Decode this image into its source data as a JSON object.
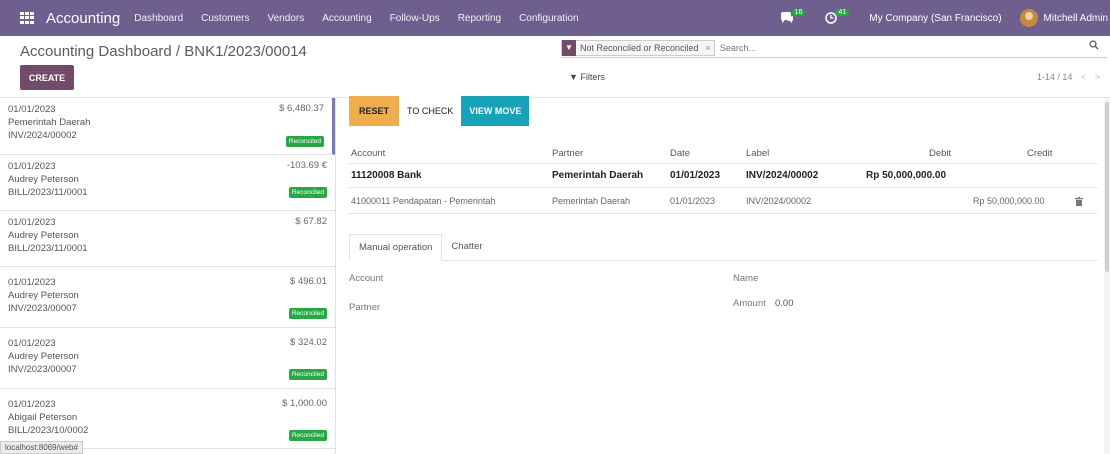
{
  "nav": {
    "app_title": "Accounting",
    "menu": [
      "Dashboard",
      "Customers",
      "Vendors",
      "Accounting",
      "Follow-Ups",
      "Reporting",
      "Configuration"
    ],
    "messages_count": "16",
    "activities_count": "41",
    "company": "My Company (San Francisco)",
    "user": "Mitchell Admin"
  },
  "control": {
    "breadcrumb": "Accounting Dashboard / BNK1/2023/00014",
    "create_label": "CREATE",
    "facet_label": "Not Reconciled or Reconciled",
    "facet_close": "×",
    "search_placeholder": "Search...",
    "filters_label": "Filters",
    "pager": "1-14 / 14"
  },
  "statements": [
    {
      "date": "01/01/2023",
      "partner": "Pemerintah Daerah",
      "ref": "INV/2024/00002",
      "amount": "$ 6,480.37",
      "status": "Reconciled"
    },
    {
      "date": "01/01/2023",
      "partner": "Audrey Peterson",
      "ref": "BILL/2023/11/0001",
      "amount": "-103.69 €",
      "status": "Reconciled"
    },
    {
      "date": "01/01/2023",
      "partner": "Audrey Peterson",
      "ref": "BILL/2023/11/0001",
      "amount": "$ 67.82",
      "status": ""
    },
    {
      "date": "01/01/2023",
      "partner": "Audrey Peterson",
      "ref": "INV/2023/00007",
      "amount": "$ 496.01",
      "status": "Reconciled"
    },
    {
      "date": "01/01/2023",
      "partner": "Audrey Peterson",
      "ref": "INV/2023/00007",
      "amount": "$ 324.02",
      "status": "Reconciled"
    },
    {
      "date": "01/01/2023",
      "partner": "Abigail Peterson",
      "ref": "BILL/2023/10/0002",
      "amount": "$ 1,000.00",
      "status": "Reconciled"
    }
  ],
  "tooltip": "localhost:8069/web#",
  "buttons": {
    "reset": "RESET",
    "to_check": "TO CHECK",
    "view_move": "VIEW MOVE"
  },
  "lines": {
    "headers": {
      "account": "Account",
      "partner": "Partner",
      "date": "Date",
      "label": "Label",
      "debit": "Debit",
      "credit": "Credit"
    },
    "rows": [
      {
        "account": "11120008 Bank",
        "partner": "Pemerintah Daerah",
        "date": "01/01/2023",
        "label": "INV/2024/00002",
        "debit": "Rp 50,000,000.00",
        "credit": ""
      },
      {
        "account": "41000011 Pendapatan - Pemerintah",
        "partner": "Pemerintah Daerah",
        "date": "01/01/2023",
        "label": "INV/2024/00002",
        "debit": "",
        "credit": "Rp 50,000,000.00"
      }
    ]
  },
  "tabs": [
    "Manual operation",
    "Chatter"
  ],
  "form": {
    "account": "Account",
    "partner": "Partner",
    "name": "Name",
    "amount_label": "Amount",
    "amount_value": "0.00"
  }
}
